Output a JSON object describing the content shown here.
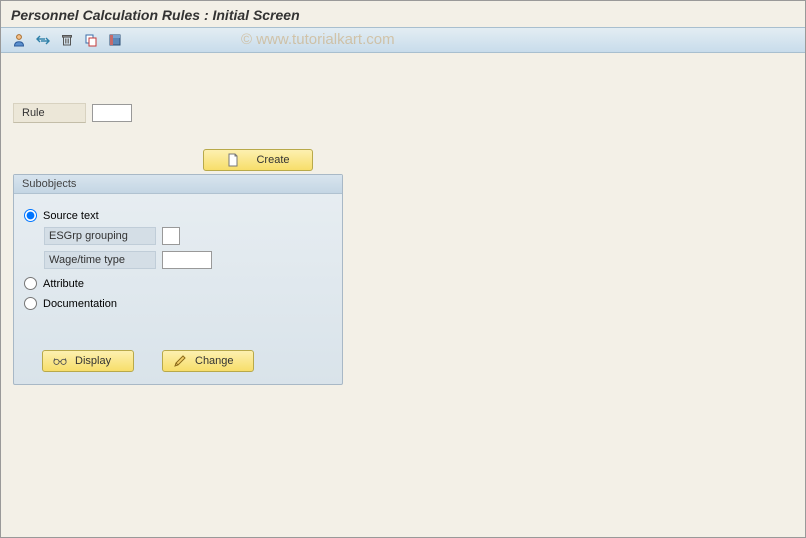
{
  "title": "Personnel Calculation Rules : Initial Screen",
  "watermark": "© www.tutorialkart.com",
  "rule": {
    "label": "Rule",
    "value": ""
  },
  "buttons": {
    "create": "Create",
    "display": "Display",
    "change": "Change"
  },
  "panel": {
    "header": "Subobjects",
    "options": {
      "source_text": "Source text",
      "attribute": "Attribute",
      "documentation": "Documentation"
    },
    "selected": "source_text",
    "fields": {
      "esgrp": {
        "label": "ESGrp grouping",
        "value": ""
      },
      "wage": {
        "label": "Wage/time type",
        "value": ""
      }
    }
  }
}
